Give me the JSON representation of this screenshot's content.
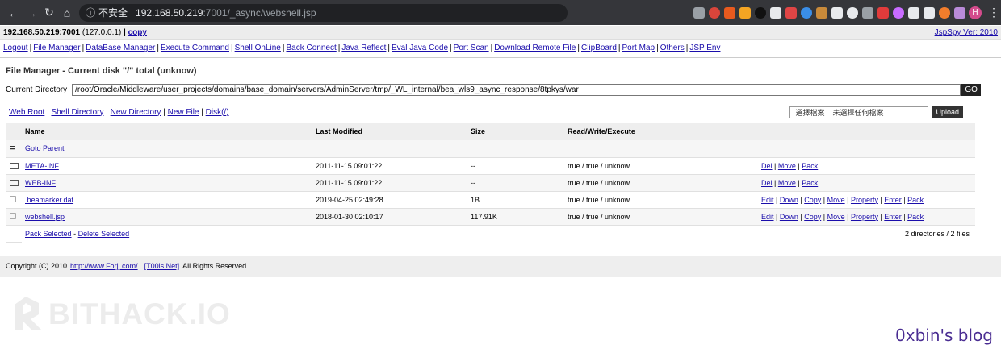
{
  "browser": {
    "url_insecure_label": "不安全",
    "url_host": "192.168.50.219",
    "url_path": ":7001/_async/webshell.jsp",
    "profile_initial": "H",
    "extension_colors": [
      "#9aa0a6",
      "#d9453b",
      "#e85a1e",
      "#f4a523",
      "#111111",
      "#e8eaed",
      "#e04545",
      "#3a8ee8",
      "#c88a3a",
      "#e8eaed",
      "#e8eaed",
      "#9aa0a6",
      "#e23b3b",
      "#c86bff",
      "#e8eaed",
      "#e8eaed",
      "#f27d2c",
      "#b98bd9"
    ]
  },
  "header": {
    "host": "192.168.50.219:7001",
    "local_ip": "(127.0.0.1)",
    "separator": "|",
    "copy_label": "copy",
    "version_link": "JspSpy Ver: 2010"
  },
  "menu": {
    "items": [
      "Logout",
      "File Manager",
      "DataBase Manager",
      "Execute Command",
      "Shell OnLine",
      "Back Connect",
      "Java Reflect",
      "Eval Java Code",
      "Port Scan",
      "Download Remote File",
      "ClipBoard",
      "Port Map",
      "Others",
      "JSP Env"
    ]
  },
  "file_manager": {
    "title": "File Manager - Current disk \"/\" total (unknow)",
    "current_dir_label": "Current Directory",
    "current_dir_value": "/root/Oracle/Middleware/user_projects/domains/base_domain/servers/AdminServer/tmp/_WL_internal/bea_wls9_async_response/8tpkys/war",
    "go_label": "GO",
    "quick_links": [
      "Web Root",
      "Shell Directory",
      "New Directory",
      "New File",
      "Disk(/)"
    ],
    "upload": {
      "choose_label": "選擇檔案",
      "no_file_label": "未選擇任何檔案",
      "upload_label": "Upload"
    },
    "columns": [
      "Name",
      "Last Modified",
      "Size",
      "Read/Write/Execute"
    ],
    "parent_icon": "=",
    "parent_label": "Goto Parent",
    "rows": [
      {
        "type": "folder",
        "name": "META-INF",
        "modified": "2011-11-15 09:01:22",
        "size": "--",
        "rwx": "true / true / unknow",
        "actions": [
          "Del",
          "Move",
          "Pack"
        ]
      },
      {
        "type": "folder",
        "name": "WEB-INF",
        "modified": "2011-11-15 09:01:22",
        "size": "--",
        "rwx": "true / true / unknow",
        "actions": [
          "Del",
          "Move",
          "Pack"
        ]
      },
      {
        "type": "file",
        "name": ".beamarker.dat",
        "modified": "2019-04-25 02:49:28",
        "size": "1B",
        "rwx": "true / true / unknow",
        "actions": [
          "Edit",
          "Down",
          "Copy",
          "Move",
          "Property",
          "Enter",
          "Pack"
        ]
      },
      {
        "type": "file",
        "name": "webshell.jsp",
        "modified": "2018-01-30 02:10:17",
        "size": "117.91K",
        "rwx": "true / true / unknow",
        "actions": [
          "Edit",
          "Down",
          "Copy",
          "Move",
          "Property",
          "Enter",
          "Pack"
        ]
      }
    ],
    "pack_selected_label": "Pack Selected",
    "dash": "-",
    "delete_selected_label": "Delete Selected",
    "summary": "2 directories / 2 files"
  },
  "footer": {
    "copyright": "Copyright (C) 2010",
    "link1": "http://www.Forjj.com/",
    "link2": "[T00ls.Net]",
    "rights": "All Rights Reserved."
  },
  "watermarks": {
    "left_text": "BITHACK.IO",
    "right_text": "0xbin's blog"
  }
}
